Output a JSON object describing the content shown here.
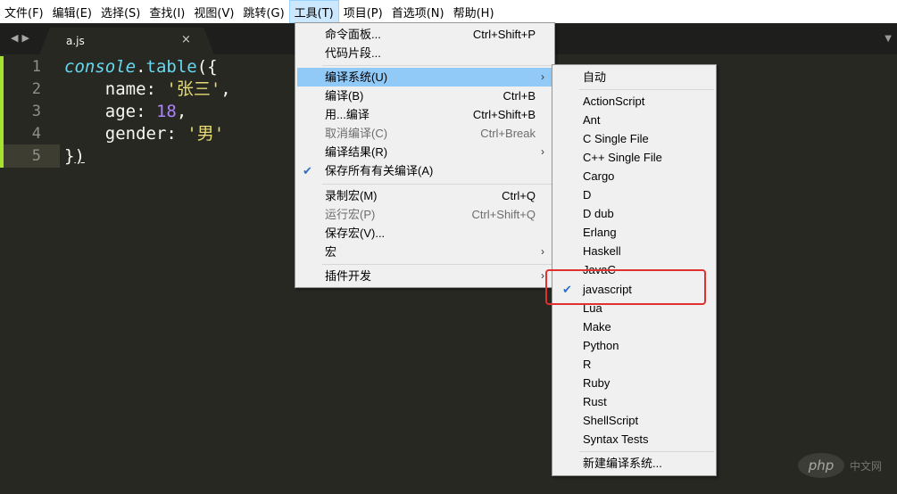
{
  "menubar": {
    "items": [
      "文件(F)",
      "编辑(E)",
      "选择(S)",
      "查找(I)",
      "视图(V)",
      "跳转(G)",
      "工具(T)",
      "项目(P)",
      "首选项(N)",
      "帮助(H)"
    ],
    "active": "工具(T)"
  },
  "tab": {
    "title": "a.js",
    "close": "×"
  },
  "editor": {
    "line_numbers": [
      "1",
      "2",
      "3",
      "4",
      "5"
    ],
    "lines": {
      "l1_obj": "console",
      "l1_rest_a": ".",
      "l1_method": "table",
      "l1_rest_b": "({",
      "l2_key": "    name: ",
      "l2_val": "'张三'",
      "l2_end": ",",
      "l3_key": "    age: ",
      "l3_val": "18",
      "l3_end": ",",
      "l4_key": "    gender: ",
      "l4_val": "'男'",
      "l5_a": "}",
      "l5_b": ")"
    }
  },
  "tools_menu": {
    "items": [
      {
        "label": "命令面板...",
        "shortcut": "Ctrl+Shift+P"
      },
      {
        "label": "代码片段..."
      },
      {
        "label": "编译系统(U)",
        "submenu": true,
        "highlighted": true
      },
      {
        "label": "编译(B)",
        "shortcut": "Ctrl+B"
      },
      {
        "label": "用...编译",
        "shortcut": "Ctrl+Shift+B"
      },
      {
        "label": "取消编译(C)",
        "shortcut": "Ctrl+Break",
        "disabled": true
      },
      {
        "label": "编译结果(R)",
        "submenu": true
      },
      {
        "label": "保存所有有关编译(A)",
        "checked": true
      },
      {
        "label": "录制宏(M)",
        "shortcut": "Ctrl+Q"
      },
      {
        "label": "运行宏(P)",
        "shortcut": "Ctrl+Shift+Q",
        "disabled": true
      },
      {
        "label": "保存宏(V)..."
      },
      {
        "label": "宏",
        "submenu": true
      },
      {
        "label": "插件开发",
        "submenu": true
      }
    ]
  },
  "build_system_menu": {
    "items": [
      "自动",
      "ActionScript",
      "Ant",
      "C Single File",
      "C++ Single File",
      "Cargo",
      "D",
      "D dub",
      "Erlang",
      "Haskell",
      "JavaC",
      "javascript",
      "Lua",
      "Make",
      "Python",
      "R",
      "Ruby",
      "Rust",
      "ShellScript",
      "Syntax Tests",
      "新建编译系统..."
    ],
    "checked": "javascript"
  },
  "watermark": {
    "logo": "php",
    "text": "中文网"
  },
  "colors": {
    "editor_bg": "#272822",
    "menu_highlight": "#91c9f7",
    "annotation_box": "#e03030",
    "gutter_mark": "#a6e22e"
  }
}
